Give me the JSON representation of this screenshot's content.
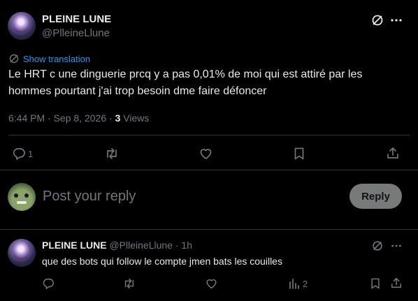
{
  "tweet": {
    "display_name": "PLEINE LUNE",
    "handle": "@PlleineLlune",
    "show_translation": "Show translation",
    "text_line1": "Le HRT c une dinguerie prcq y a pas 0,01% de moi qui est attiré par les",
    "text_line2": "hommes pourtant j'ai trop besoin dme faire défoncer",
    "time": "6:44 PM",
    "date": "Sep 8, 2026",
    "views_count": "3",
    "views_label": "Views",
    "reply_count": "1"
  },
  "composer": {
    "placeholder": "Post your reply",
    "button_label": "Reply"
  },
  "reply": {
    "display_name": "PLEINE LUNE",
    "handle": "@PlleineLlune",
    "time": "1h",
    "text": "que des bots qui follow le compte jmen bats les couilles",
    "views_count": "2"
  },
  "colors": {
    "background": "#000000",
    "text": "#e7e9ea",
    "muted": "#71767b",
    "accent": "#1d9bf0",
    "divider": "#2f3336"
  }
}
